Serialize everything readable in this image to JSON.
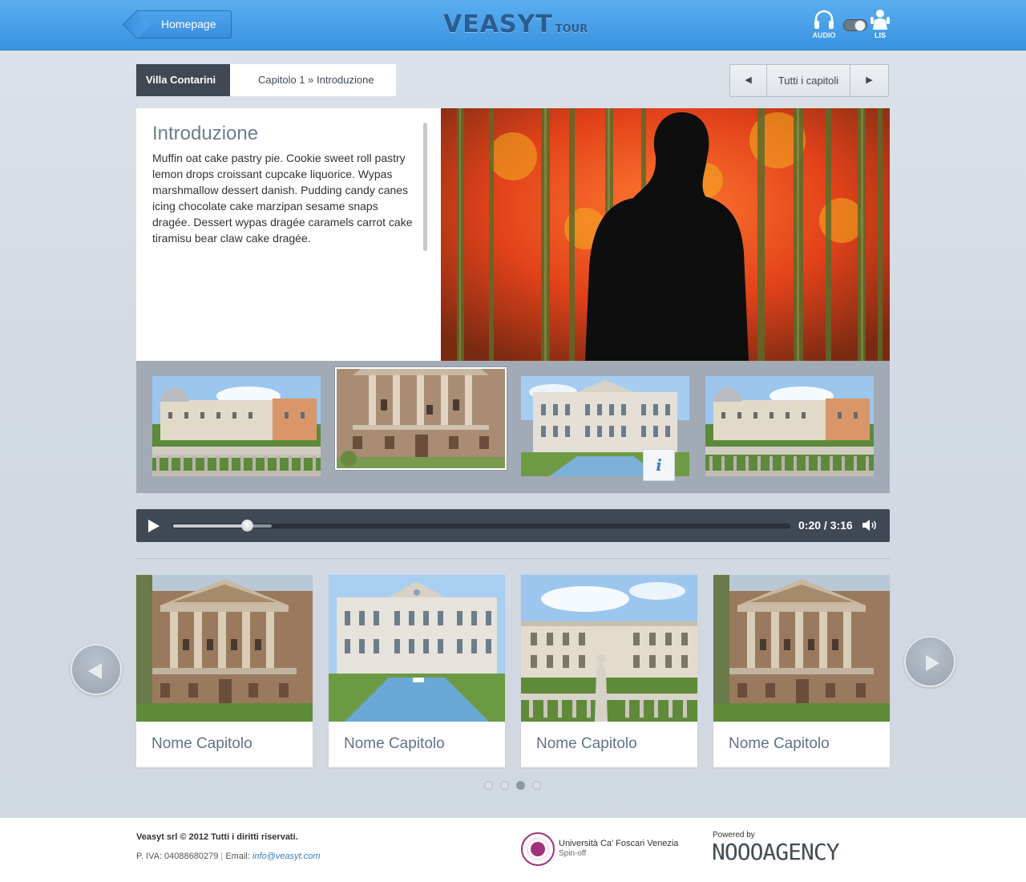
{
  "header": {
    "home_label": "Homepage",
    "logo_main": "VEASYT",
    "logo_sub": "TOUR",
    "audio_label": "AUDIO",
    "lis_label": "LIS",
    "accent": "#3a93e0"
  },
  "breadcrumb": {
    "place": "Villa Contarini",
    "chapter": "Capitolo 1 » Introduzione"
  },
  "chapter_nav": {
    "prev_icon": "◀",
    "all_label": "Tutti i capitoli",
    "next_icon": "▶"
  },
  "content": {
    "title": "Introduzione",
    "body": "Muffin oat cake pastry pie. Cookie sweet roll pastry lemon drops croissant cupcake liquorice. Wypas marshmallow dessert danish. Pudding candy canes icing chocolate cake marzipan sesame snaps dragée. Dessert wypas dragée caramels carrot cake tiramisu bear claw cake dragée."
  },
  "thumbnails": {
    "selected_index": 1,
    "info_label": "i"
  },
  "player": {
    "time": "0:20 / 3:16",
    "progress": 0.12,
    "buffered": 0.16
  },
  "chapters": [
    {
      "label": "Nome Capitolo"
    },
    {
      "label": "Nome Capitolo"
    },
    {
      "label": "Nome Capitolo"
    },
    {
      "label": "Nome Capitolo"
    }
  ],
  "pagination": {
    "count": 4,
    "active": 2
  },
  "footer": {
    "copyright": "Veasyt srl © 2012 Tutti i diritti riservati.",
    "piva_text": "P. IVA: 04088680279",
    "email_prefix": "Email:",
    "email": "info@veasyt.com",
    "university": "Università Ca’ Foscari Venezia",
    "university_sub": "Spin-off",
    "powered_by": "Powered by",
    "agency": "NOOOAGENCY"
  }
}
